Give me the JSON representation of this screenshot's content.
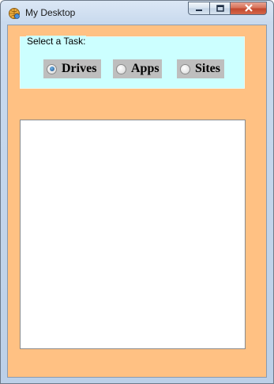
{
  "window": {
    "title": "My Desktop",
    "icon": "app-globe-icon",
    "controls": [
      "minimize-icon",
      "maximize-icon",
      "close-icon"
    ]
  },
  "task_group": {
    "title": "Select a Task:",
    "options": [
      {
        "label": "Drives",
        "checked": true
      },
      {
        "label": "Apps",
        "checked": false
      },
      {
        "label": "Sites",
        "checked": false
      }
    ]
  },
  "colors": {
    "client_background": "#ffc183",
    "groupbox_background": "#ccffff",
    "radio_background": "#bebebe",
    "panel_background": "#ffffff"
  }
}
